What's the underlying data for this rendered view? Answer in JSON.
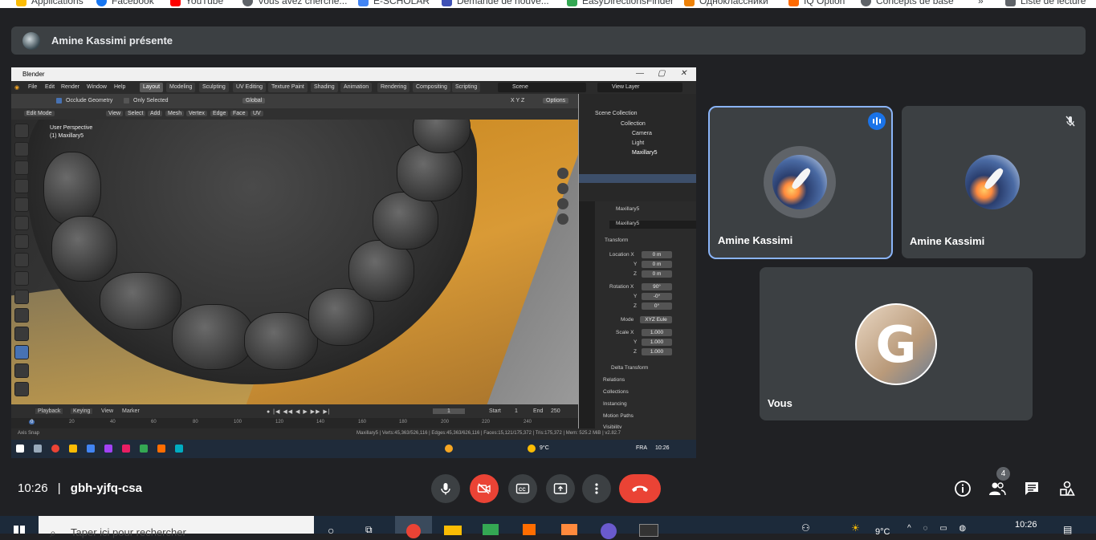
{
  "bookmarks": [
    {
      "label": "Applications",
      "color": "#fbbc04"
    },
    {
      "label": "Facebook",
      "color": "#1877f2"
    },
    {
      "label": "YouTube",
      "color": "#ff0000"
    },
    {
      "label": "Vous avez cherché...",
      "color": "#5f6368"
    },
    {
      "label": "E-SCHOLAR",
      "color": "#4285f4"
    },
    {
      "label": "Demande de nouve...",
      "color": "#3f51b5"
    },
    {
      "label": "EasyDirectionsFinder",
      "color": "#34a853"
    },
    {
      "label": "Одноклассники",
      "color": "#ee8208"
    },
    {
      "label": "IQ Option",
      "color": "#ff6a00"
    },
    {
      "label": "Concepts de base",
      "color": "#5f6368"
    },
    {
      "label": "»",
      "color": ""
    },
    {
      "label": "Liste de lecture",
      "color": "#5f6368"
    }
  ],
  "presenter": {
    "text": "Amine Kassimi présente"
  },
  "blender": {
    "title": "Blender",
    "menus": [
      "File",
      "Edit",
      "Render",
      "Window",
      "Help"
    ],
    "workspaces": [
      "Layout",
      "Modeling",
      "Sculpting",
      "UV Editing",
      "Texture Paint",
      "Shading",
      "Animation",
      "Rendering",
      "Compositing",
      "Scripting"
    ],
    "scene_field": "Scene",
    "view_layer_field": "View Layer",
    "header": {
      "occlude": "Occlude Geometry",
      "only_selected": "Only Selected",
      "orientation": "Global",
      "axes": "X Y Z",
      "options": "Options"
    },
    "header2": {
      "mode": "Edit Mode",
      "items": [
        "View",
        "Select",
        "Add",
        "Mesh",
        "Vertex",
        "Edge",
        "Face",
        "UV"
      ]
    },
    "viewport_text": {
      "line1": "User Perspective",
      "line2": "(1) Maxillary5"
    },
    "timeline": {
      "playback": "Playback",
      "keying": "Keying",
      "view": "View",
      "marker": "Marker",
      "current": "1",
      "start_label": "Start",
      "start": "1",
      "end_label": "End",
      "end": "250",
      "ticks": [
        "0",
        "20",
        "40",
        "60",
        "80",
        "100",
        "120",
        "140",
        "160",
        "180",
        "200",
        "220",
        "240"
      ]
    },
    "status": {
      "left": "Axis Snap",
      "right": "Maxillary5 | Verts:45,363/526,116 | Edges:45,363/626,116 | Faces:15,121/175,372 | Tris:175,372 | Mem: 525.2 MiB | v2.82.7"
    },
    "outliner": {
      "title": "Scene Collection",
      "items": [
        "Collection",
        "Camera",
        "Light",
        "Maxillary5"
      ]
    },
    "properties": {
      "object": "Maxillary5",
      "object_field": "Maxillary5",
      "transform": "Transform",
      "location_label": "Location X",
      "location": [
        "0 m",
        "0 m",
        "0 m"
      ],
      "rotation_label": "Rotation X",
      "rotation": [
        "90°",
        "-0°",
        "0°"
      ],
      "mode_label": "Mode",
      "mode_value": "XYZ Eule",
      "scale_label": "Scale X",
      "scale": [
        "1.000",
        "1.000",
        "1.000"
      ],
      "axis_y": "Y",
      "axis_z": "Z",
      "delta": "Delta Transform",
      "panels": [
        "Relations",
        "Collections",
        "Instancing",
        "Motion Paths",
        "Visibility"
      ]
    },
    "taskbar": {
      "temp": "9°C",
      "lang": "FRA",
      "time": "10:26"
    }
  },
  "participants": [
    {
      "name": "Amine Kassimi",
      "speaking": true
    },
    {
      "name": "Amine Kassimi",
      "muted": true
    },
    {
      "name": "Vous"
    }
  ],
  "bottom_bar": {
    "time": "10:26",
    "separator": "|",
    "meeting_code": "gbh-yjfq-csa",
    "people_count": "4",
    "colors": {
      "hangup": "#ea4335",
      "control": "#3c4043"
    }
  },
  "windows_taskbar": {
    "search_placeholder": "Taper ici pour rechercher",
    "temp": "9°C",
    "time": "10:26"
  }
}
